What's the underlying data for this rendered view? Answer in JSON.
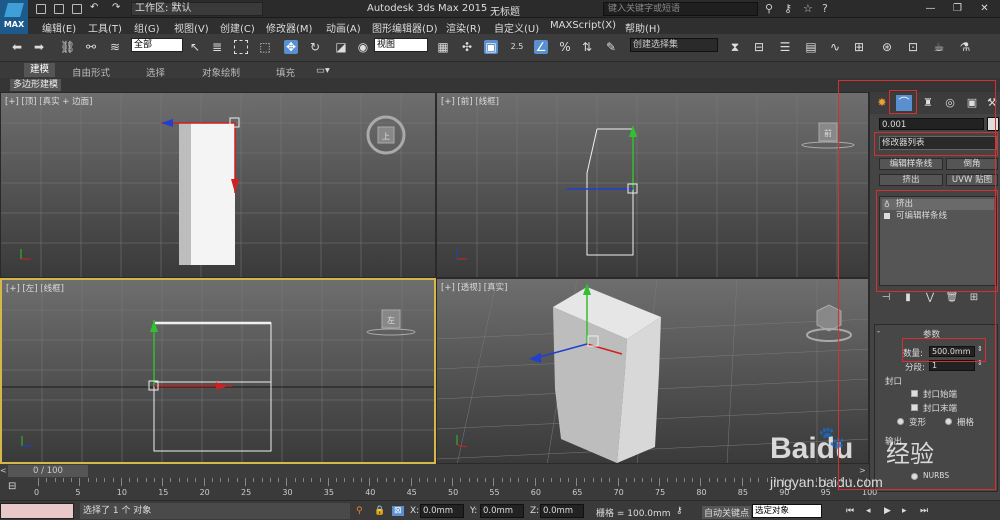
{
  "titlebar": {
    "logo": "MAX",
    "workspace": "工作区: 默认",
    "app_title": "Autodesk 3ds Max  2015",
    "doc_title": "无标题",
    "search_placeholder": "键入关键字或短语",
    "win_controls": [
      "—",
      "❐",
      "✕"
    ]
  },
  "menubar": {
    "items": [
      "编辑(E)",
      "工具(T)",
      "组(G)",
      "视图(V)",
      "创建(C)",
      "修改器(M)",
      "动画(A)",
      "图形编辑器(D)",
      "渲染(R)",
      "自定义(U)",
      "MAXScript(X)",
      "帮助(H)"
    ]
  },
  "toolbar": {
    "selection_filter": "全部",
    "ref_coord": "视图",
    "named_selection": "创建选择集",
    "snap_value": "2.5",
    "percent_label": "%"
  },
  "ribbon": {
    "tabs": [
      "建模",
      "自由形式",
      "选择",
      "对象绘制",
      "填充"
    ],
    "active_tab": "建模",
    "sub_label": "多边形建模"
  },
  "viewports": {
    "top": {
      "label": "[+] [顶] [真实 + 边面]"
    },
    "front": {
      "label": "[+] [前] [线框]"
    },
    "left": {
      "label": "[+] [左] [线框]"
    },
    "persp": {
      "label": "[+] [透视] [真实]"
    },
    "axis": {
      "x": "x",
      "y": "y",
      "z": "z"
    },
    "viewcube_top": "上",
    "viewcube_front": "前",
    "viewcube_left": "左"
  },
  "command_panel": {
    "object_name": "0.001",
    "modifier_list": "修改器列表",
    "buttons": [
      "编辑样条线",
      "倒角",
      "挤出",
      "UVW 贴图"
    ],
    "stack": [
      "挤出",
      "可编辑样条线"
    ],
    "params_title": "参数",
    "amount_label": "数量:",
    "amount_value": "500.0mm",
    "segments_label": "分段:",
    "segments_value": "1",
    "cap_title": "封口",
    "cap_start": "封口始端",
    "cap_end": "封口末端",
    "morph": "变形",
    "grid": "栅格",
    "output_title": "输出",
    "nurbs": "NURBS"
  },
  "timeline": {
    "slider": "0 / 100",
    "ticks": [
      "0",
      "5",
      "10",
      "15",
      "20",
      "25",
      "30",
      "35",
      "40",
      "45",
      "50",
      "55",
      "60",
      "65",
      "70",
      "75",
      "80",
      "85",
      "90",
      "95",
      "100"
    ]
  },
  "statusbar": {
    "message": "选择了 1 个 对象",
    "x_label": "X:",
    "x_value": "0.0mm",
    "y_label": "Y:",
    "y_value": "0.0mm",
    "z_label": "Z:",
    "z_value": "0.0mm",
    "grid": "栅格 = 100.0mm",
    "autokey": "自动关键点",
    "selected": "选定对象"
  },
  "watermark": {
    "brand": "Baidu",
    "cn": "经验",
    "url": "jingyan.baidu.com"
  },
  "colors": {
    "accent_red": "#d53030",
    "active_viewport": "#d6b84a",
    "axis_x": "#d02020",
    "axis_y": "#30c030",
    "axis_z": "#2040d0"
  }
}
